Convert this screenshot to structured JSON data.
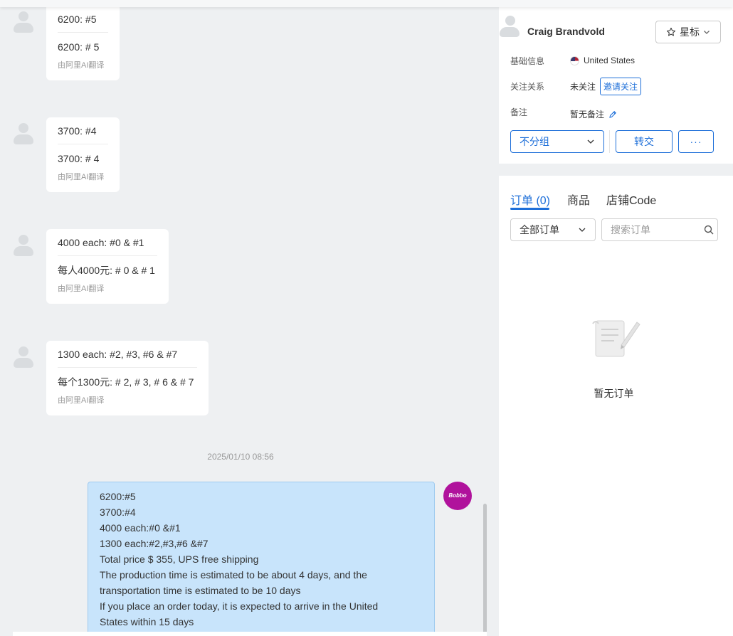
{
  "messages": [
    {
      "original": "6200: #5",
      "translation": "6200: # 5",
      "note": "由阿里AI翻译"
    },
    {
      "original": "3700: #4",
      "translation": "3700: # 4",
      "note": "由阿里AI翻译"
    },
    {
      "original": "4000 each: #0 & #1",
      "translation": "每人4000元: # 0 & # 1",
      "note": "由阿里AI翻译"
    },
    {
      "original": "1300 each: #2, #3, #6 & #7",
      "translation": "每个1300元: # 2, # 3, # 6 & # 7",
      "note": "由阿里AI翻译"
    }
  ],
  "timestamp": "2025/01/10 08:56",
  "outgoing": {
    "lines": [
      "6200:#5",
      "3700:#4",
      "4000 each:#0 &#1",
      "1300 each:#2,#3,#6 &#7",
      "Total price $ 355, UPS free shipping",
      "The production time is estimated to be about 4 days, and the",
      "transportation time is estimated to be 10 days",
      "If you place an order today, it is expected to arrive in the United",
      "States within 15 days"
    ],
    "avatar_text": "Bobbo"
  },
  "customer": {
    "name": "Craig Brandvold",
    "star_label": "星标",
    "basic_info_label": "基础信息",
    "country": "United States",
    "follow_label": "关注关系",
    "follow_status": "未关注",
    "invite_label": "邀请关注",
    "remark_label": "备注",
    "remark_value": "暂无备注",
    "group_select": "不分组",
    "transfer_label": "转交",
    "more_label": "···"
  },
  "orders": {
    "tabs": [
      "订单 (0)",
      "商品",
      "店铺Code"
    ],
    "filter_select": "全部订单",
    "search_placeholder": "搜索订单",
    "empty_text": "暂无订单"
  },
  "colors": {
    "accent": "#1e6fd9",
    "outgoing_bubble": "#c8e4fb",
    "brand_avatar": "#b0129c"
  }
}
